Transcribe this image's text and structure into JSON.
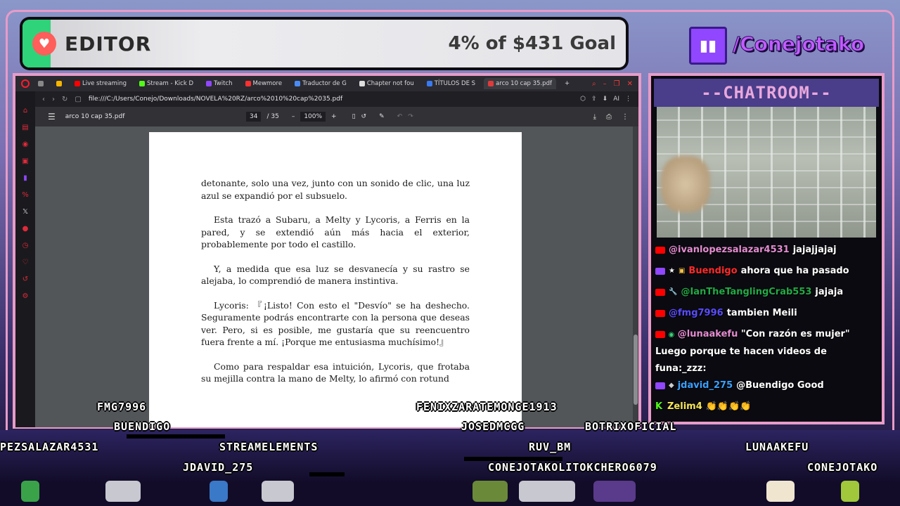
{
  "goal": {
    "title": "EDITOR",
    "amount": "4% of $431 Goal",
    "progress_percent": 4,
    "accent_color": "#2fd37a"
  },
  "channel": {
    "handle": "/Conejotako",
    "icon": "twitch-icon"
  },
  "browser": {
    "tabs": [
      {
        "label": "Live streaming",
        "icon": "youtube-icon"
      },
      {
        "label": "Stream - Kick D",
        "icon": "kick-icon"
      },
      {
        "label": "Twitch",
        "icon": "twitch-icon"
      },
      {
        "label": "Mewmore",
        "icon": "speaker-icon"
      },
      {
        "label": "Traductor de G",
        "icon": "translate-icon"
      },
      {
        "label": "Chapter not fou",
        "icon": "page-icon"
      },
      {
        "label": "TÍTULOS DE S",
        "icon": "doc-icon"
      },
      {
        "label": "arco 10 cap 35.pdf",
        "icon": "pdf-icon",
        "active": true
      }
    ],
    "new_tab": "+",
    "url": "file:///C:/Users/Conejo/Downloads/NOVELA%20RZ/arco%2010%20cap%2035.pdf",
    "ai_label": "AI"
  },
  "pdf": {
    "filename": "arco 10 cap 35.pdf",
    "page_current": "34",
    "page_total": "/ 35",
    "zoom": "100%",
    "paragraphs": [
      {
        "text": "detonante, solo una vez, junto con un sonido de clic, una luz azul se expandió por el subsuelo.",
        "indent": false
      },
      {
        "text": "Esta trazó a Subaru, a Melty y Lycoris, a Ferris en la pared, y se extendió aún más hacia el exterior, probablemente por todo el castillo.",
        "indent": true
      },
      {
        "text": "Y, a medida que esa luz se desvanecía y su rastro se alejaba, lo comprendió de manera instintiva.",
        "indent": true
      },
      {
        "text": "Lycoris: 『¡Listo! Con esto el \"Desvío\" se ha deshecho. Seguramente podrás encontrarte con la persona que deseas ver. Pero, si es posible, me gustaría que su reencuentro fuera frente a mí. ¡Porque me entusiasma muchísimo!』",
        "indent": true
      },
      {
        "text": "Como para respaldar esa intuición, Lycoris, que frotaba su mejilla contra la mano de Melty, lo afirmó con rotund",
        "indent": true
      }
    ]
  },
  "chat": {
    "header": "--CHATROOM--",
    "messages": [
      {
        "platform": "youtube",
        "user": "@ivanlopezsalazar4531",
        "user_color": "#e48cd0",
        "text": "jajajjajaj"
      },
      {
        "platform": "twitch",
        "user": "Buendigo",
        "user_color": "#ff2a2a",
        "text": "ahora que ha pasado",
        "extra_badges": [
          "star-badge",
          "gift-badge"
        ]
      },
      {
        "platform": "youtube",
        "user": "@IanTheTanglingCrab553",
        "user_color": "#22aa44",
        "text": "jajaja",
        "extra_badges": [
          "wrench-badge"
        ]
      },
      {
        "platform": "youtube",
        "user": "@fmg7996",
        "user_color": "#5a4cff",
        "text": "tambien Meili"
      },
      {
        "platform": "youtube",
        "user": "@lunaakefu",
        "user_color": "#e48cd0",
        "text": "\"Con razón es mujer\" Luego porque te hacen videos de funa:_zzz:",
        "extra_badges": [
          "money-badge"
        ]
      },
      {
        "platform": "twitch",
        "user": "jdavid_275",
        "user_color": "#3aa0ff",
        "text": "@Buendigo Good",
        "extra_badges": [
          "bits-badge"
        ]
      },
      {
        "platform": "kick",
        "user": "Zelim4",
        "user_color": "#f5e65a",
        "text": "👏👏👏👏"
      }
    ]
  },
  "viewers": [
    {
      "name": "FMG7996"
    },
    {
      "name": "BUENDIGO"
    },
    {
      "name": "PEZSALAZAR4531"
    },
    {
      "name": "STREAMELEMENTS"
    },
    {
      "name": "JDAVID_275"
    },
    {
      "name": "FENIXZARATEMONGE1913"
    },
    {
      "name": "JOSEDMCGG"
    },
    {
      "name": "BOTRIXOFICIAL"
    },
    {
      "name": "RUV_BM"
    },
    {
      "name": "CONEJOTAKOLITOKCHERO6079"
    },
    {
      "name": "LUNAAKEFU"
    },
    {
      "name": "CONEJOTAKO"
    }
  ]
}
